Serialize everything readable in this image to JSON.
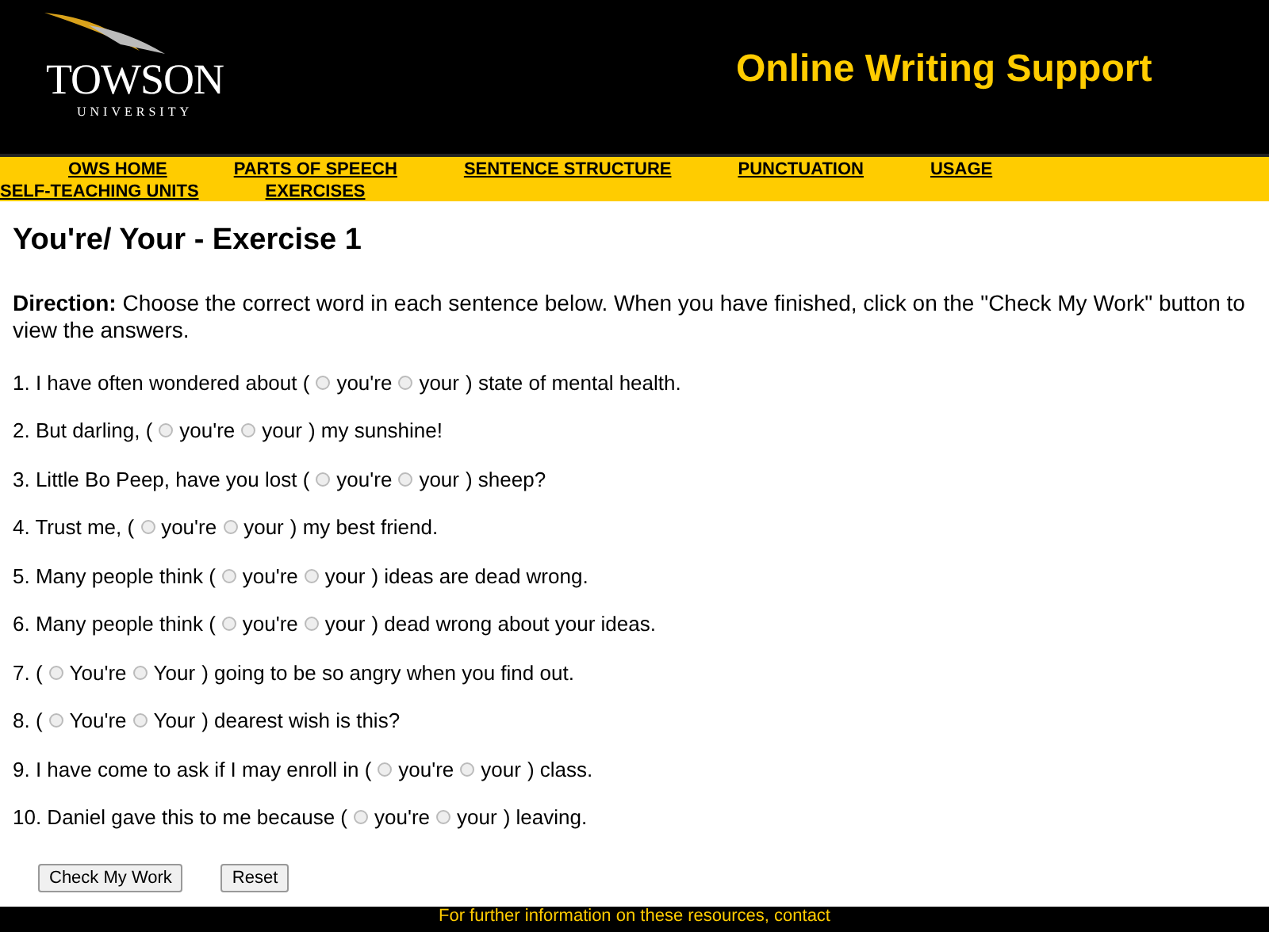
{
  "header": {
    "logo_name": "TOWSON",
    "logo_subtitle": "UNIVERSITY",
    "title": "Online Writing Support"
  },
  "nav": [
    {
      "label": "OWS HOME"
    },
    {
      "label": "PARTS OF SPEECH"
    },
    {
      "label": "SENTENCE STRUCTURE"
    },
    {
      "label": "PUNCTUATION"
    },
    {
      "label": "USAGE"
    },
    {
      "label": "SELF-TEACHING UNITS"
    },
    {
      "label": "EXERCISES"
    }
  ],
  "page_title": "You're/ Your - Exercise 1",
  "direction": "**Direction:** Choose the correct word in each sentence below. When you have finished, click on the \"Check My Work\" button to view the answers.",
  "questions": [
    {
      "before": "1. I have often wondered about (",
      "options": [
        {
          "label": "you're",
          "selected": false
        },
        {
          "label": "your",
          "selected": false
        }
      ],
      "after": ") state of mental health."
    },
    {
      "before": "2. But darling, (",
      "options": [
        {
          "label": "you're",
          "selected": false
        },
        {
          "label": "your",
          "selected": false
        }
      ],
      "after": ") my sunshine!"
    },
    {
      "before": "3. Little Bo Peep, have you lost (",
      "options": [
        {
          "label": "you're",
          "selected": false
        },
        {
          "label": "your",
          "selected": false
        }
      ],
      "after": ") sheep?"
    },
    {
      "before": "4. Trust me, (",
      "options": [
        {
          "label": "you're",
          "selected": false
        },
        {
          "label": "your",
          "selected": false
        }
      ],
      "after": ") my best friend."
    },
    {
      "before": "5. Many people think (",
      "options": [
        {
          "label": "you're",
          "selected": false
        },
        {
          "label": "your",
          "selected": false
        }
      ],
      "after": ") ideas are dead wrong."
    },
    {
      "before": "6. Many people think (",
      "options": [
        {
          "label": "you're",
          "selected": false
        },
        {
          "label": "your",
          "selected": false
        }
      ],
      "after": ") dead wrong about your ideas."
    },
    {
      "before": "7. (",
      "options": [
        {
          "label": "You're",
          "selected": false
        },
        {
          "label": "Your",
          "selected": false
        }
      ],
      "after": ") going to be so angry when you find out."
    },
    {
      "before": "8. (",
      "options": [
        {
          "label": "You're",
          "selected": false
        },
        {
          "label": "Your",
          "selected": false
        }
      ],
      "after": ") dearest wish is this?"
    },
    {
      "before": "9. I have come to ask if I may enroll in (",
      "options": [
        {
          "label": "you're",
          "selected": false
        },
        {
          "label": "your",
          "selected": false
        }
      ],
      "after": ") class."
    },
    {
      "before": "10. Daniel gave this to me because (",
      "options": [
        {
          "label": "you're",
          "selected": false
        },
        {
          "label": "your",
          "selected": false
        }
      ],
      "after": ") leaving."
    }
  ],
  "buttons": [
    {
      "label": "Check My Work"
    },
    {
      "label": "Reset"
    }
  ],
  "footer": "For further information on these resources, contact"
}
